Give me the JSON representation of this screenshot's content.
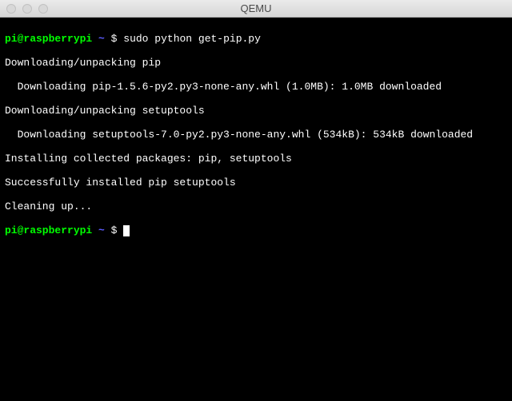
{
  "window": {
    "title": "QEMU"
  },
  "prompt": {
    "user_host": "pi@raspberrypi",
    "path": "~",
    "symbol": "$"
  },
  "commands": {
    "cmd1": "sudo python get-pip.py"
  },
  "output": {
    "l1": "Downloading/unpacking pip",
    "l2": "  Downloading pip-1.5.6-py2.py3-none-any.whl (1.0MB): 1.0MB downloaded",
    "l3": "Downloading/unpacking setuptools",
    "l4": "  Downloading setuptools-7.0-py2.py3-none-any.whl (534kB): 534kB downloaded",
    "l5": "Installing collected packages: pip, setuptools",
    "l6": "Successfully installed pip setuptools",
    "l7": "Cleaning up..."
  }
}
